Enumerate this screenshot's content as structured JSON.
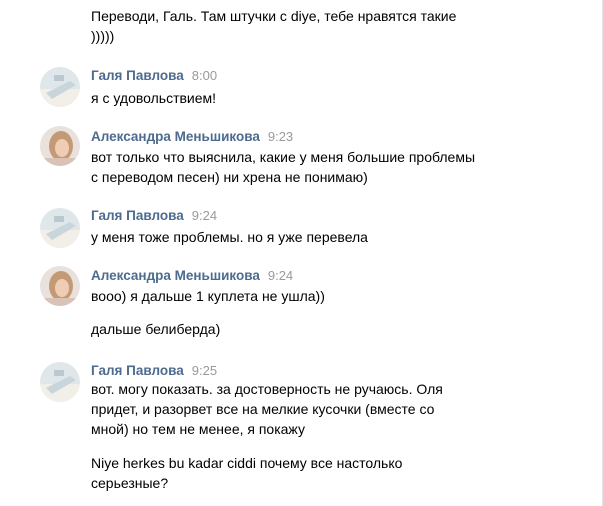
{
  "messages": [
    {
      "text_lines": [
        "Переводи, Галь. Там штучки с diye, тебе нравятся такие",
        ")))))"
      ]
    },
    {
      "author": "Галя Павлова",
      "time": "8:00",
      "text_lines": [
        "я с удовольствием!"
      ]
    },
    {
      "author": "Александра Меньшикова",
      "time": "9:23",
      "text_lines": [
        "вот только что выяснила, какие у меня большие проблемы",
        "с переводом песен) ни хрена не понимаю)"
      ]
    },
    {
      "author": "Галя Павлова",
      "time": "9:24",
      "text_lines": [
        "у меня тоже проблемы. но я уже перевела"
      ]
    },
    {
      "author": "Александра Меньшикова",
      "time": "9:24",
      "text_lines": [
        "вооо) я дальше 1 куплета не ушла))"
      ]
    },
    {
      "text_lines": [
        "дальше белиберда)"
      ]
    },
    {
      "author": "Галя Павлова",
      "time": "9:25",
      "text_lines": [
        "вот. могу показать. за достоверность не ручаюсь. Оля",
        "придет, и разорвет все на мелкие кусочки (вместе со",
        "мной) но тем не менее, я покажу"
      ]
    },
    {
      "text_lines": [
        "Niye herkes bu kadar ciddi почему все настолько",
        "серьезные?"
      ]
    }
  ]
}
